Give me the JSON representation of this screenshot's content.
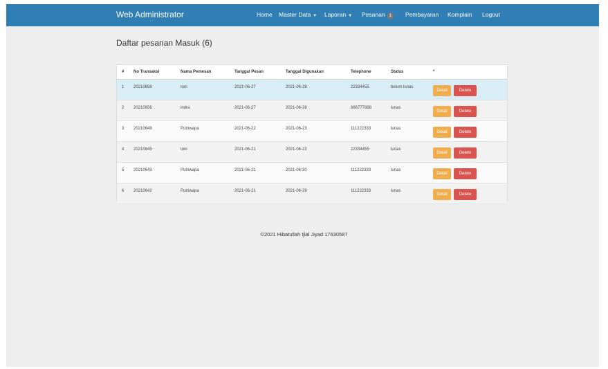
{
  "brand": "Web Administrator",
  "nav": {
    "home": "Home",
    "master": "Master Data",
    "laporan": "Laporan",
    "pesanan": "Pesanan",
    "pesanan_badge": "1",
    "pembayaran": "Pembayaran",
    "komplain": "Komplain",
    "logout": "Logout"
  },
  "page_title": "Daftar pesanan Masuk (6)",
  "table": {
    "headers": [
      "#",
      "No Transaksi",
      "Nama Pemesan",
      "Tanggal Pesan",
      "Tanggal Digunakan",
      "Telephone",
      "Status",
      "*"
    ],
    "rows": [
      {
        "no": "1",
        "trx": "20210658",
        "name": "toni",
        "tgl_pesan": "2021-06-27",
        "tgl_guna": "2021-06-28",
        "phone": "22334455",
        "status": "belum lunas"
      },
      {
        "no": "2",
        "trx": "20210656",
        "name": "indra",
        "tgl_pesan": "2021-06-27",
        "tgl_guna": "2021-06-28",
        "phone": "666777888",
        "status": "lunas"
      },
      {
        "no": "3",
        "trx": "20210649",
        "name": "Putriwapa",
        "tgl_pesan": "2021-06-22",
        "tgl_guna": "2021-06-23",
        "phone": "111222333",
        "status": "lunas"
      },
      {
        "no": "4",
        "trx": "20210645",
        "name": "toni",
        "tgl_pesan": "2021-06-21",
        "tgl_guna": "2021-06-22",
        "phone": "22334455",
        "status": "lunas"
      },
      {
        "no": "5",
        "trx": "20210643",
        "name": "Putriwapa",
        "tgl_pesan": "2021-06-21",
        "tgl_guna": "2021-06-30",
        "phone": "111222333",
        "status": "lunas"
      },
      {
        "no": "6",
        "trx": "20210642",
        "name": "Putriwapa",
        "tgl_pesan": "2021-06-21",
        "tgl_guna": "2021-06-29",
        "phone": "111222333",
        "status": "lunas"
      }
    ],
    "detail_label": "Detail",
    "delete_label": "Delete"
  },
  "footer": "©2021 Hibatullah Ijlal Jiyad 17630587",
  "colors": {
    "navbar": "#2f7fb5",
    "detail": "#f0ad4e",
    "delete": "#d9534f",
    "highlight_row": "#d9edf7"
  }
}
